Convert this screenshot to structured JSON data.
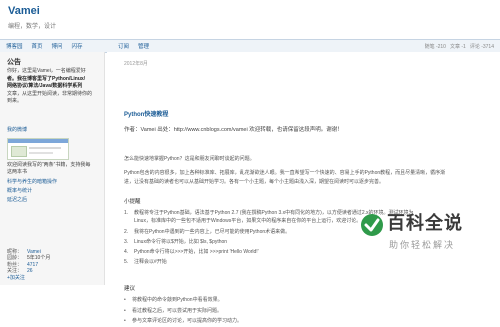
{
  "header": {
    "site_title": "Vamei",
    "subtitle": "编程，数学，设计"
  },
  "nav": {
    "left_items": [
      "博客园",
      "首页",
      "博问",
      "闪存"
    ],
    "right_items": [
      "订阅",
      "管理"
    ],
    "stats": [
      "随笔 -210",
      "文章 -1",
      "评论 -3714"
    ]
  },
  "sidebar": {
    "heading": "公告",
    "intro_lines": [
      "你好，这里是Vamei，一名编程爱好",
      "者。我在博客里写了Python/Linux/",
      "网络协议/算法/Java/数据科学系列",
      "文章，从这里开始阅读，非常期待你的",
      "到来。"
    ],
    "follow_link": "我的微博",
    "promo_lines": [
      "欢迎阅读我写的“两条”书籍，支持我每",
      "这两本书"
    ],
    "links": [
      "科学与养生的暗箱操作",
      "概率与统计",
      "延迟之后"
    ],
    "profile": [
      {
        "k": "昵称：",
        "v": "Vamei"
      },
      {
        "k": "园龄：",
        "v": "5年10个月"
      },
      {
        "k": "粉丝：",
        "v": "4717"
      },
      {
        "k": "关注：",
        "v": "26"
      }
    ],
    "follow_button": "+加关注"
  },
  "main": {
    "date": "2012年8月",
    "post_title": "Python快速教程",
    "author_line": "作者：Vamei 出处：http://www.cnblogs.com/vamei 欢迎转载，也请保留这段声明。谢谢！",
    "para_intro": "怎么能快速地掌握Python？这是和朋友闲聊时谈起的问题。",
    "para_desc_1": "Python包含的内容很多，加上各种标准库、拓展库，乱花渐欲迷人眼。我一直希望写一个快速的、容易上手的Python教程，而且尽量清晰，循序渐",
    "para_desc_2": "进，让没有基础的读者也可以从基础开始学习。各有一个小主题，每个小主题由浅入深，期望在阅读时可以逐步完善。",
    "section_title": "小提醒",
    "tips": [
      "教程将专注于Python基础，语法基于Python 2.7 (我在撰稿Python 3.x中有同化的地方)，以方便读者通过2.x的环境。测试环境为Linux，标准库中的一些包不适用于Windows平台，如果文中的程序来自在你的平台上运行，欢迎讨论。",
      "我将在Python中遇到的一些内容上，已尽可能的使用Python术语来做。",
      "Linux命令行将以$开始，比如 $ls, $python",
      "Python命令行将以>>>开始，比如 >>>print 'Hello World!'",
      "注释会以#开始"
    ],
    "advice_title": "建议",
    "advice": [
      "将教程中的命令敲到Python中看看效果。",
      "看过教程之后，可以尝试用于实际问题。",
      "参与文章评论区的讨论，可以提高你的学习动力。"
    ]
  },
  "watermark": {
    "title": "百科全说",
    "subtitle": "助你轻松解决"
  }
}
